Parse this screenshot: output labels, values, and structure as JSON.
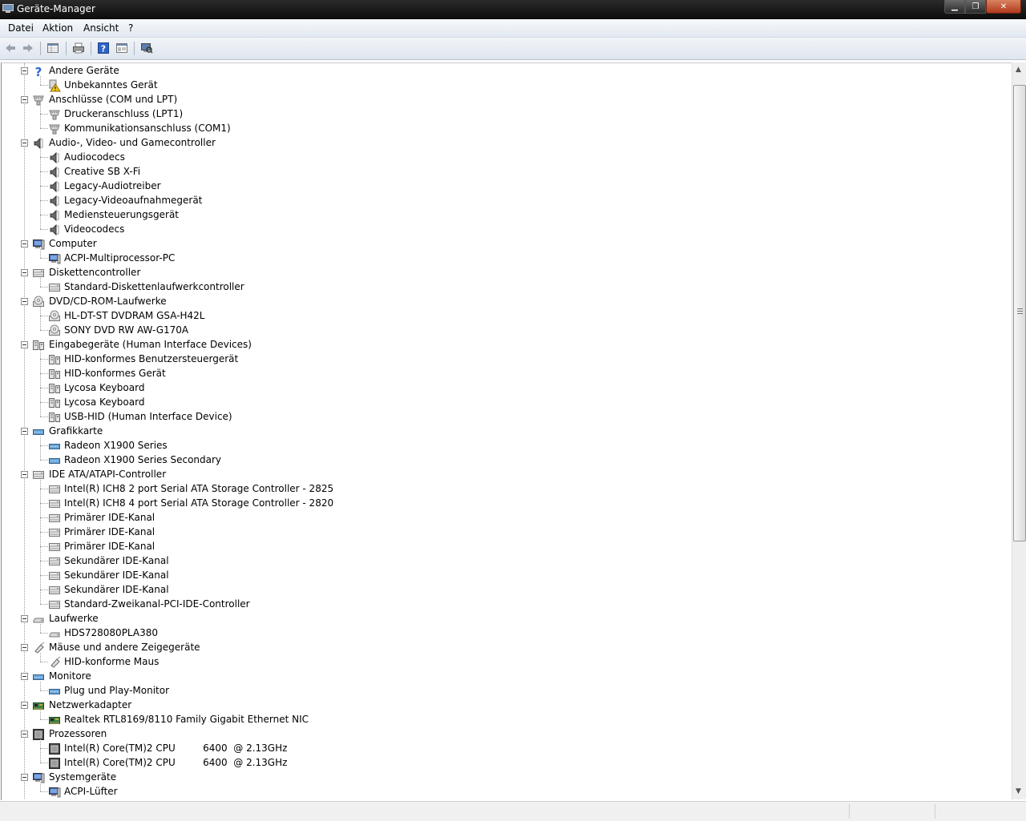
{
  "window": {
    "title": "Geräte-Manager",
    "icon": "device-manager-icon"
  },
  "window_controls": {
    "minimize": "▁",
    "maximize": "❐",
    "close": "✕"
  },
  "menu": [
    "Datei",
    "Aktion",
    "Ansicht",
    "?"
  ],
  "toolbar": [
    "back-arrow-icon",
    "forward-arrow-icon",
    "properties-grid-icon",
    "print-icon",
    "help-icon",
    "details-pane-icon",
    "scan-hardware-icon"
  ],
  "colors": {
    "titlebar": "#1a1a1a",
    "menubar": "#eef2f7",
    "tree_bg": "#ffffff",
    "close_button": "#c6502f"
  },
  "tree": [
    {
      "label": "Andere Geräte",
      "icon": "question-icon",
      "children": [
        {
          "label": "Unbekanntes Gerät",
          "icon": "warning-icon"
        }
      ]
    },
    {
      "label": "Anschlüsse (COM und LPT)",
      "icon": "port-icon",
      "children": [
        {
          "label": "Druckeranschluss (LPT1)",
          "icon": "port-icon"
        },
        {
          "label": "Kommunikationsanschluss (COM1)",
          "icon": "port-icon"
        }
      ]
    },
    {
      "label": "Audio-, Video- und Gamecontroller",
      "icon": "speaker-icon",
      "children": [
        {
          "label": "Audiocodecs",
          "icon": "speaker-icon"
        },
        {
          "label": "Creative SB X-Fi",
          "icon": "speaker-icon"
        },
        {
          "label": "Legacy-Audiotreiber",
          "icon": "speaker-icon"
        },
        {
          "label": "Legacy-Videoaufnahmegerät",
          "icon": "speaker-icon"
        },
        {
          "label": "Mediensteuerungsgerät",
          "icon": "speaker-icon"
        },
        {
          "label": "Videocodecs",
          "icon": "speaker-icon"
        }
      ]
    },
    {
      "label": "Computer",
      "icon": "computer-icon",
      "children": [
        {
          "label": "ACPI-Multiprocessor-PC",
          "icon": "computer-icon"
        }
      ]
    },
    {
      "label": "Diskettencontroller",
      "icon": "controller-icon",
      "children": [
        {
          "label": "Standard-Diskettenlaufwerkcontroller",
          "icon": "controller-icon"
        }
      ]
    },
    {
      "label": "DVD/CD-ROM-Laufwerke",
      "icon": "dvd-drive-icon",
      "children": [
        {
          "label": "HL-DT-ST DVDRAM GSA-H42L",
          "icon": "dvd-drive-icon"
        },
        {
          "label": "SONY DVD RW AW-G170A",
          "icon": "dvd-drive-icon"
        }
      ]
    },
    {
      "label": "Eingabegeräte (Human Interface Devices)",
      "icon": "hid-icon",
      "children": [
        {
          "label": "HID-konformes Benutzersteuergerät",
          "icon": "hid-icon"
        },
        {
          "label": "HID-konformes Gerät",
          "icon": "hid-icon"
        },
        {
          "label": "Lycosa Keyboard",
          "icon": "hid-icon"
        },
        {
          "label": "Lycosa Keyboard",
          "icon": "hid-icon"
        },
        {
          "label": "USB-HID (Human Interface Device)",
          "icon": "hid-icon"
        }
      ]
    },
    {
      "label": "Grafikkarte",
      "icon": "display-adapter-icon",
      "children": [
        {
          "label": "Radeon X1900 Series",
          "icon": "display-adapter-icon"
        },
        {
          "label": "Radeon X1900 Series Secondary",
          "icon": "display-adapter-icon"
        }
      ]
    },
    {
      "label": "IDE ATA/ATAPI-Controller",
      "icon": "controller-icon",
      "children": [
        {
          "label": "Intel(R) ICH8 2 port Serial ATA Storage Controller - 2825",
          "icon": "controller-icon"
        },
        {
          "label": "Intel(R) ICH8 4 port Serial ATA Storage Controller - 2820",
          "icon": "controller-icon"
        },
        {
          "label": "Primärer IDE-Kanal",
          "icon": "controller-icon"
        },
        {
          "label": "Primärer IDE-Kanal",
          "icon": "controller-icon"
        },
        {
          "label": "Primärer IDE-Kanal",
          "icon": "controller-icon"
        },
        {
          "label": "Sekundärer IDE-Kanal",
          "icon": "controller-icon"
        },
        {
          "label": "Sekundärer IDE-Kanal",
          "icon": "controller-icon"
        },
        {
          "label": "Sekundärer IDE-Kanal",
          "icon": "controller-icon"
        },
        {
          "label": "Standard-Zweikanal-PCI-IDE-Controller",
          "icon": "controller-icon"
        }
      ]
    },
    {
      "label": "Laufwerke",
      "icon": "disk-drive-icon",
      "children": [
        {
          "label": "HDS728080PLA380",
          "icon": "disk-drive-icon"
        }
      ]
    },
    {
      "label": "Mäuse und andere Zeigegeräte",
      "icon": "mouse-icon",
      "children": [
        {
          "label": "HID-konforme Maus",
          "icon": "mouse-icon"
        }
      ]
    },
    {
      "label": "Monitore",
      "icon": "display-adapter-icon",
      "children": [
        {
          "label": "Plug und Play-Monitor",
          "icon": "display-adapter-icon"
        }
      ]
    },
    {
      "label": "Netzwerkadapter",
      "icon": "network-card-icon",
      "children": [
        {
          "label": "Realtek RTL8169/8110 Family Gigabit Ethernet NIC",
          "icon": "network-card-icon"
        }
      ]
    },
    {
      "label": "Prozessoren",
      "icon": "processor-icon",
      "children": [
        {
          "label": "Intel(R) Core(TM)2 CPU         6400  @ 2.13GHz",
          "icon": "processor-icon"
        },
        {
          "label": "Intel(R) Core(TM)2 CPU         6400  @ 2.13GHz",
          "icon": "processor-icon"
        }
      ]
    },
    {
      "label": "Systemgeräte",
      "icon": "computer-icon",
      "children": [
        {
          "label": "ACPI-Lüfter",
          "icon": "computer-icon"
        }
      ]
    }
  ]
}
